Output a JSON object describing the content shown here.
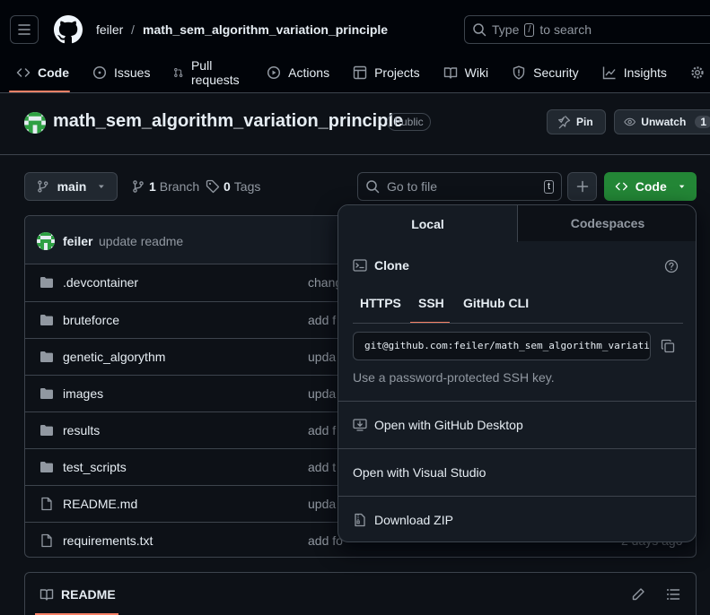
{
  "header": {
    "owner": "feiler",
    "separator": "/",
    "repo": "math_sem_algorithm_variation_principle",
    "search_prefix": "Type",
    "search_key": "/",
    "search_suffix": "to search"
  },
  "tabs": [
    {
      "label": "Code",
      "icon": "code-icon"
    },
    {
      "label": "Issues",
      "icon": "issue-icon"
    },
    {
      "label": "Pull requests",
      "icon": "pull-request-icon"
    },
    {
      "label": "Actions",
      "icon": "play-icon"
    },
    {
      "label": "Projects",
      "icon": "table-icon"
    },
    {
      "label": "Wiki",
      "icon": "book-icon"
    },
    {
      "label": "Security",
      "icon": "shield-icon"
    },
    {
      "label": "Insights",
      "icon": "graph-icon"
    }
  ],
  "repo": {
    "title": "math_sem_algorithm_variation_principle",
    "visibility": "Public",
    "pin_label": "Pin",
    "watch_label": "Unwatch",
    "watch_count": "1"
  },
  "branch": {
    "name": "main",
    "branch_count": "1",
    "branch_label": "Branch",
    "tag_count": "0",
    "tag_label": "Tags",
    "goto_placeholder": "Go to file",
    "goto_key": "t",
    "code_label": "Code"
  },
  "commit": {
    "author": "feiler",
    "message": "update readme"
  },
  "files": [
    {
      "name": ".devcontainer",
      "type": "folder",
      "msg": "chang"
    },
    {
      "name": "bruteforce",
      "type": "folder",
      "msg": "add f"
    },
    {
      "name": "genetic_algorythm",
      "type": "folder",
      "msg": "upda"
    },
    {
      "name": "images",
      "type": "folder",
      "msg": "upda"
    },
    {
      "name": "results",
      "type": "folder",
      "msg": "add f"
    },
    {
      "name": "test_scripts",
      "type": "folder",
      "msg": "add t"
    },
    {
      "name": "README.md",
      "type": "file",
      "msg": "upda"
    },
    {
      "name": "requirements.txt",
      "type": "file",
      "msg": "add fo",
      "date": "2 days ago"
    }
  ],
  "readme": {
    "label": "README"
  },
  "dropdown": {
    "tab_local": "Local",
    "tab_codespaces": "Codespaces",
    "clone_label": "Clone",
    "protocols": [
      "HTTPS",
      "SSH",
      "GitHub CLI"
    ],
    "active_protocol": "SSH",
    "url": "git@github.com:feiler/math_sem_algorithm_variation_principle.git",
    "hint": "Use a password-protected SSH key.",
    "open_desktop": "Open with GitHub Desktop",
    "open_vs": "Open with Visual Studio",
    "download_zip": "Download ZIP"
  },
  "colors": {
    "background": "#0d1117",
    "accent": "#f78166",
    "code_button": "#238636",
    "border": "#3d444d"
  }
}
